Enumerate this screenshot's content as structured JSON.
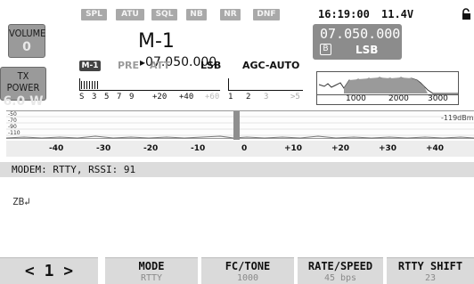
{
  "left": {
    "volume": {
      "label": "VOLUME",
      "value": "0"
    },
    "txpower": {
      "label": "TX POWER",
      "value": "6.0 W"
    }
  },
  "flags": [
    "SPL",
    "ATU",
    "SQL",
    "NB",
    "NR",
    "DNF"
  ],
  "status": {
    "time": "16:19:00",
    "voltage": "11.4V"
  },
  "vfo_a": {
    "memory": "M-1",
    "arrow": "▸",
    "freq": "07.050.000"
  },
  "vfo_b": {
    "freq": "07.050.000",
    "letter": "B",
    "mode": "LSB"
  },
  "mode_row": {
    "chip": "M-1",
    "pre": "PRE",
    "att": "ATT",
    "mode": "LSB",
    "agc": "AGC-AUTO"
  },
  "smeter": {
    "s_labels": [
      "S",
      "3",
      "5",
      "7",
      "9",
      "+20",
      "+40",
      "+60"
    ],
    "pwr_labels": [
      "1",
      "2",
      "3",
      ">5"
    ]
  },
  "scope": {
    "labels": [
      "1000",
      "2000",
      "3000"
    ]
  },
  "spectrum": {
    "db_labels": [
      "-50",
      "-70",
      "-90",
      "-110"
    ],
    "ref": "-119dBm",
    "axis": [
      "-40",
      "-30",
      "-20",
      "-10",
      "0",
      "+10",
      "+20",
      "+30",
      "+40"
    ]
  },
  "modem": {
    "status": "MODEM: RTTY, RSSI: 91",
    "text": "ZB↲"
  },
  "keys": {
    "page": "< 1 >",
    "mode": {
      "title": "MODE",
      "value": "RTTY"
    },
    "fctone": {
      "title": "FC/TONE",
      "value": "1000"
    },
    "rate": {
      "title": "RATE/SPEED",
      "value": "45 bps"
    },
    "shift": {
      "title": "RTTY SHIFT",
      "value": "23"
    }
  }
}
